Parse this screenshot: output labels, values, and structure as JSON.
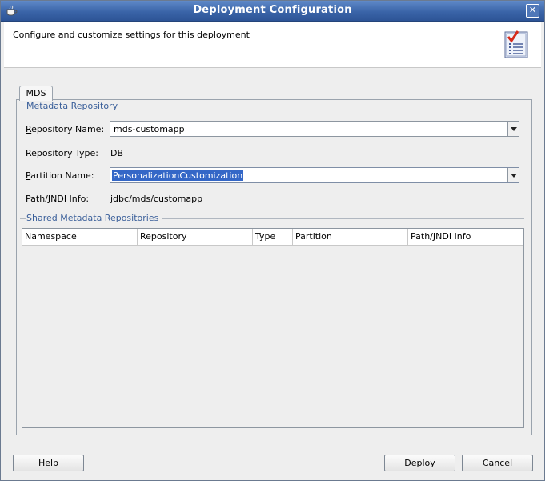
{
  "window": {
    "title": "Deployment Configuration",
    "close_glyph": "✕",
    "description": "Configure and customize settings for this deployment"
  },
  "icons": {
    "app": "java-cup-icon",
    "close": "close-icon",
    "header": "checklist-icon"
  },
  "tabs": [
    {
      "label": "MDS",
      "selected": true
    }
  ],
  "metadata_repository": {
    "section_label": "Metadata Repository",
    "repository_name": {
      "label_mnemonic": "R",
      "label_rest": "epository Name:",
      "value": "mds-customapp"
    },
    "repository_type": {
      "label": "Repository Type:",
      "value": "DB"
    },
    "partition_name": {
      "label_mnemonic": "P",
      "label_rest": "artition Name:",
      "value": "PersonalizationCustomization"
    },
    "path_jndi": {
      "label": "Path/JNDI Info:",
      "value": "jdbc/mds/customapp"
    }
  },
  "shared_repositories": {
    "section_label": "Shared Metadata Repositories",
    "columns": [
      "Namespace",
      "Repository",
      "Type",
      "Partition",
      "Path/JNDI Info"
    ],
    "rows": []
  },
  "buttons": {
    "help": {
      "mnemonic": "H",
      "rest": "elp"
    },
    "deploy": {
      "mnemonic": "D",
      "rest": "eploy"
    },
    "cancel": {
      "label": "Cancel"
    }
  },
  "colors": {
    "title_bar": "#3a64a8",
    "section_label": "#3a5f9a",
    "selection": "#3467c7"
  }
}
